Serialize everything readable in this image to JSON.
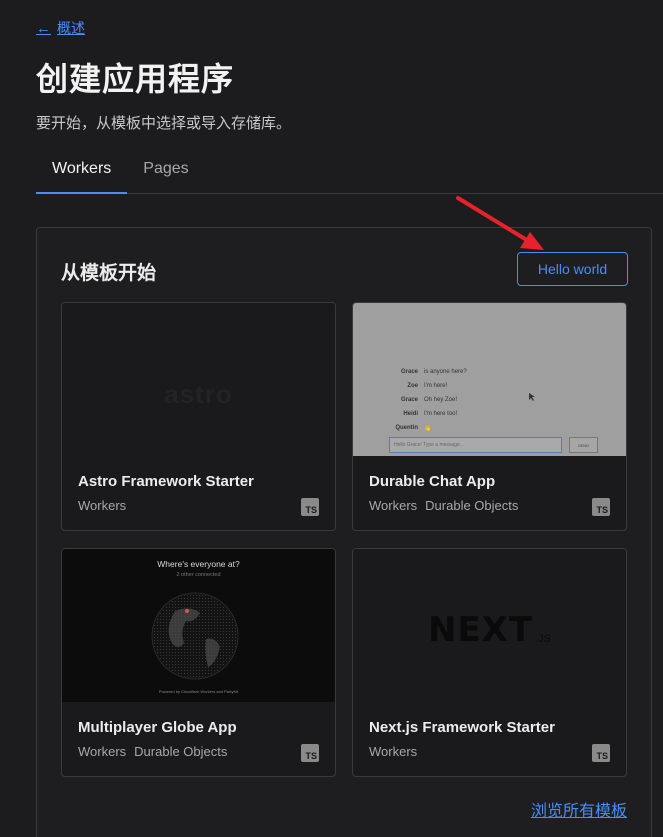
{
  "nav": {
    "back_label": "概述"
  },
  "header": {
    "title": "创建应用程序",
    "subtitle": "要开始，从模板中选择或导入存储库。"
  },
  "tabs": [
    {
      "label": "Workers",
      "active": true
    },
    {
      "label": "Pages",
      "active": false
    }
  ],
  "templates": {
    "section_title": "从模板开始",
    "hello_button": "Hello world",
    "view_all_label": "浏览所有模板",
    "cards": [
      {
        "name": "Astro Framework Starter",
        "tags": [
          "Workers"
        ],
        "badge": "TS",
        "thumb": {
          "logo_text": "astro"
        }
      },
      {
        "name": "Durable Chat App",
        "tags": [
          "Workers",
          "Durable Objects"
        ],
        "badge": "TS",
        "thumb": {
          "messages": [
            {
              "user": "Grace",
              "text": "is anyone here?"
            },
            {
              "user": "Zoe",
              "text": "I'm here!"
            },
            {
              "user": "Grace",
              "text": "Oh hey Zoe!"
            },
            {
              "user": "Heidi",
              "text": "I'm here too!"
            },
            {
              "user": "Quentin",
              "text": "👋"
            }
          ],
          "input_placeholder": "Hello Grace! Type a message...",
          "send_label": "SEND"
        }
      },
      {
        "name": "Multiplayer Globe App",
        "tags": [
          "Workers",
          "Durable Objects"
        ],
        "badge": "TS",
        "thumb": {
          "title": "Where's everyone at?",
          "subtitle": "2 other connected",
          "footer": "Powered by Cloudflare Workers and PartyKit"
        }
      },
      {
        "name": "Next.js Framework Starter",
        "tags": [
          "Workers"
        ],
        "badge": "TS",
        "thumb": {
          "logo_text": "NEXT",
          "logo_suffix": ".JS"
        }
      }
    ]
  },
  "colors": {
    "accent": "#4a8df8",
    "background": "#1c1c1e",
    "annotation_arrow": "#e8222a"
  }
}
